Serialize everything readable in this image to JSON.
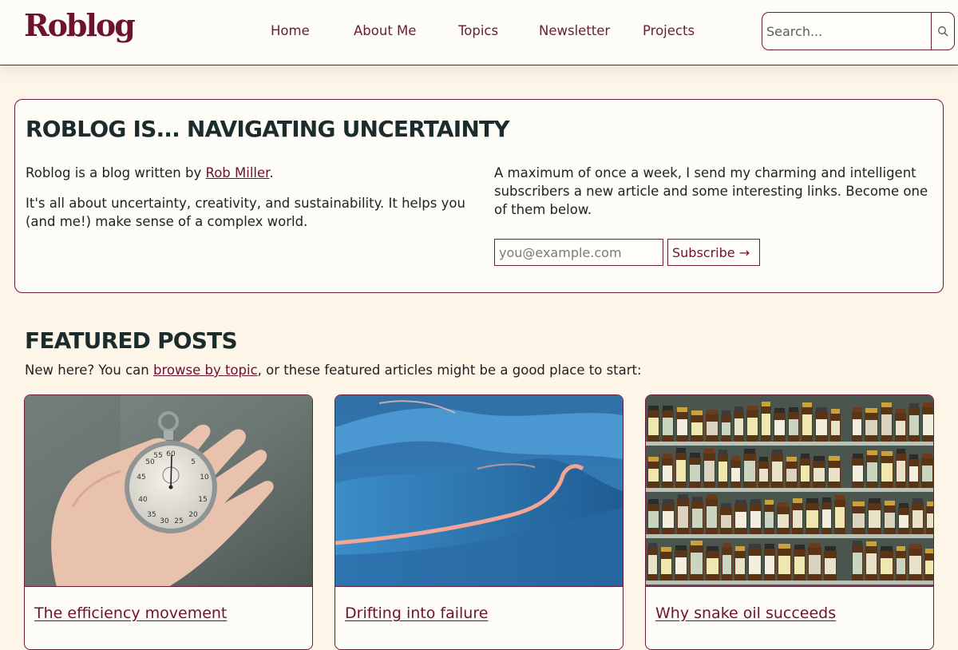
{
  "header": {
    "logo": "Roblog",
    "nav": [
      "Home",
      "About Me",
      "Topics",
      "Newsletter",
      "Projects"
    ],
    "search_placeholder": "Search...",
    "search_icon": "search-icon"
  },
  "intro": {
    "title": "ROBLOG IS... NAVIGATING UNCERTAINTY",
    "written_prefix": "Roblog is a blog written by ",
    "author_link": "Rob Miller",
    "written_suffix": ".",
    "about": "It's all about uncertainty, creativity, and sustainability. It helps you (and me!) make sense of a complex world.",
    "newsletter_text": "A maximum of once a week, I send my charming and intelligent subscribers a new article and some interesting links. Become one of them below.",
    "email_placeholder": "you@example.com",
    "subscribe_label": "Subscribe →"
  },
  "featured": {
    "title": "FEATURED POSTS",
    "intro_prefix": "New here? You can ",
    "intro_link": "browse by topic",
    "intro_suffix": ", or these featured articles might be a good place to start:",
    "posts": [
      {
        "title": "The efficiency movement",
        "image": "stopwatch-in-hand"
      },
      {
        "title": "Drifting into failure",
        "image": "blue-sand-dunes"
      },
      {
        "title": "Why snake oil succeeds",
        "image": "shelves-of-supplement-bottles"
      }
    ]
  },
  "colors": {
    "accent": "#6e1232",
    "background": "#fdf5e8",
    "heading": "#1c2b2b"
  }
}
